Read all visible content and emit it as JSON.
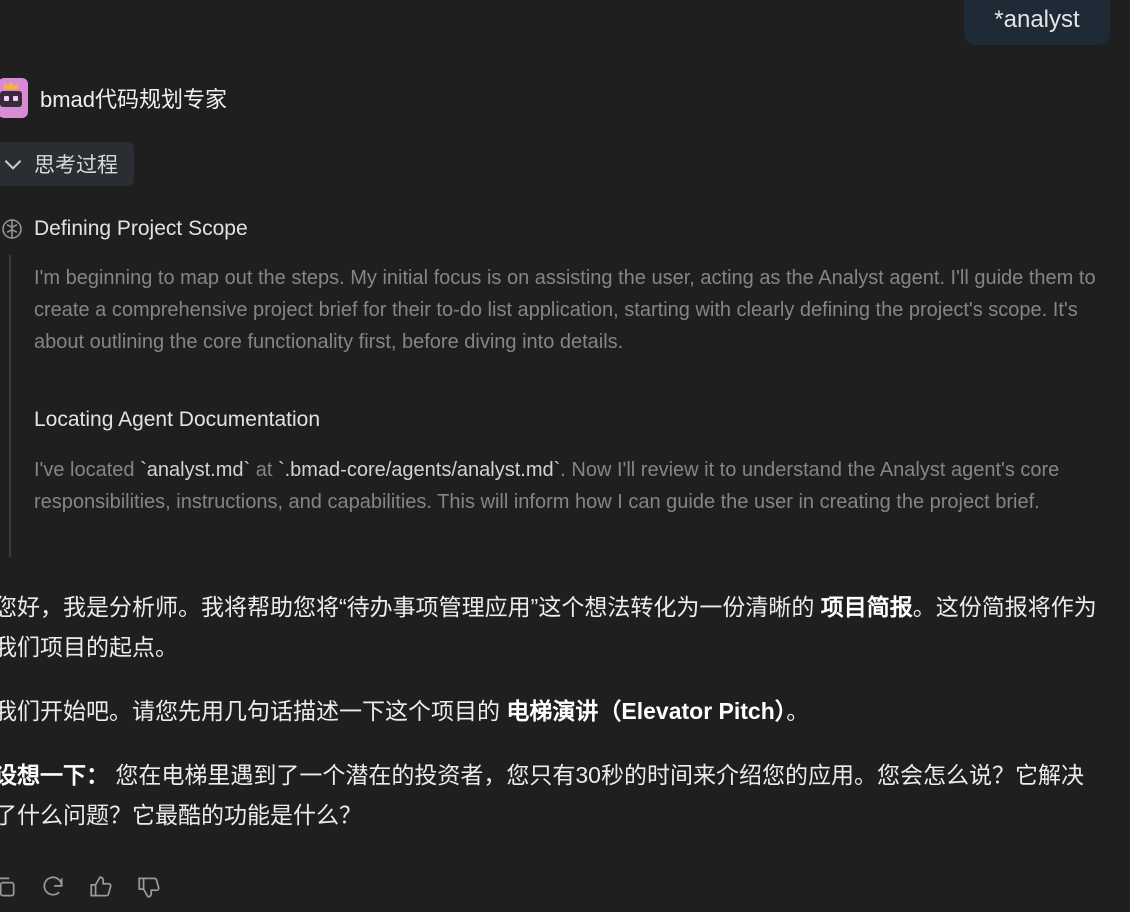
{
  "user_message": "*analyst",
  "agent": {
    "name": "bmad代码规划专家"
  },
  "thinking": {
    "toggle_label": "思考过程",
    "steps": [
      {
        "title": "Defining Project Scope",
        "text": "I'm beginning to map out the steps. My initial focus is on assisting the user, acting as the Analyst agent. I'll guide them to create a comprehensive project brief for their to-do list application, starting with clearly defining the project's scope. It's about outlining the core functionality first, before diving into details."
      },
      {
        "title": "Locating Agent Documentation",
        "text_parts": {
          "p1": "I've located ",
          "c1": "`analyst.md`",
          "p2": " at ",
          "c2": "`.bmad-core/agents/analyst.md`",
          "p3": ". Now I'll review it to understand the Analyst agent's core responsibilities, instructions, and capabilities. This will inform how I can guide the user in creating the project brief."
        }
      }
    ]
  },
  "response": {
    "p1_a": "您好，我是分析师。我将帮助您将“待办事项管理应用”这个想法转化为一份清晰的 ",
    "p1_b": "项目简报",
    "p1_c": "。这份简报将作为我们项目的起点。",
    "p2_a": "我们开始吧。请您先用几句话描述一下这个项目的 ",
    "p2_b": "电梯演讲（Elevator Pitch）",
    "p2_c": "。",
    "p3_a": "设想一下：",
    "p3_b": " 您在电梯里遇到了一个潜在的投资者，您只有30秒的时间来介绍您的应用。您会怎么说？它解决了什么问题？它最酷的功能是什么？"
  },
  "actions": [
    "copy-icon",
    "regenerate-icon",
    "thumbs-up-icon",
    "thumbs-down-icon"
  ]
}
